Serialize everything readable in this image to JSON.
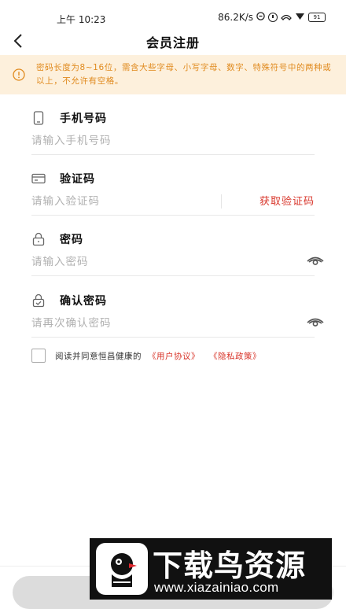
{
  "status_bar": {
    "time": "上午 10:23",
    "speed": "86.2K/s",
    "battery": "91"
  },
  "header": {
    "title": "会员注册"
  },
  "notice": {
    "text": "密码长度为8~16位，需含大些字母、小写字母、数字、特殊符号中的两种或以上，不允许有空格。"
  },
  "form": {
    "phone": {
      "label": "手机号码",
      "placeholder": "请输入手机号码"
    },
    "code": {
      "label": "验证码",
      "placeholder": "请输入验证码",
      "button": "获取验证码"
    },
    "password": {
      "label": "密码",
      "placeholder": "请输入密码"
    },
    "confirm": {
      "label": "确认密码",
      "placeholder": "请再次确认密码"
    }
  },
  "agreement": {
    "text": "阅读并同意恒昌健康的",
    "user_agreement": "《用户协议》",
    "privacy_policy": "《隐私政策》"
  },
  "watermark": {
    "title": "下载鸟资源",
    "url": "www.xiazainiao.com"
  },
  "colors": {
    "accent_red": "#d8352a",
    "notice_bg": "#fdf0dc",
    "notice_text": "#e08a1e"
  }
}
